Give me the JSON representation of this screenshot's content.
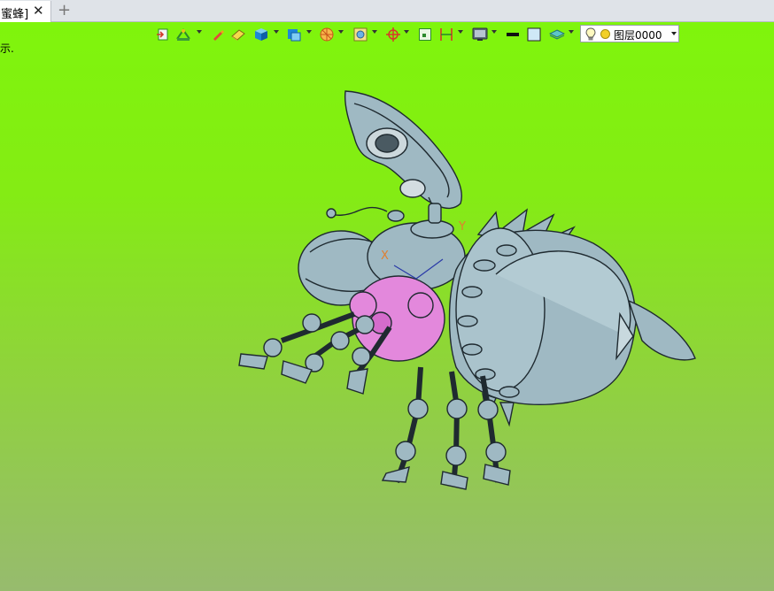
{
  "tab": {
    "label": "[蜜蜂]",
    "close_glyph": "✕",
    "add_glyph": "+"
  },
  "viewport": {
    "hint_text": "示.",
    "background_top": "#7ff50c",
    "background_bottom": "#97bb6e",
    "triad": {
      "x_label": "X",
      "y_label": "Y"
    }
  },
  "toolbar": {
    "icons": [
      "exit-sketch-icon",
      "line-style-icon",
      "pencil-icon",
      "eraser-icon",
      "view-cube-icon",
      "display-mode-icon",
      "section-view-icon",
      "render-icon",
      "snap-point-icon",
      "fit-view-icon",
      "dimension-icon",
      "monitor-icon",
      "line-color-icon",
      "fill-color-icon",
      "layer-stack-icon"
    ],
    "layer": {
      "label": "图层0000",
      "bulb_icon": "lightbulb-icon",
      "state_color": "#f2d028"
    }
  },
  "model": {
    "body_color": "#9fb9c3",
    "highlight_color": "#e388dc",
    "outline_color": "#1f2a30"
  }
}
